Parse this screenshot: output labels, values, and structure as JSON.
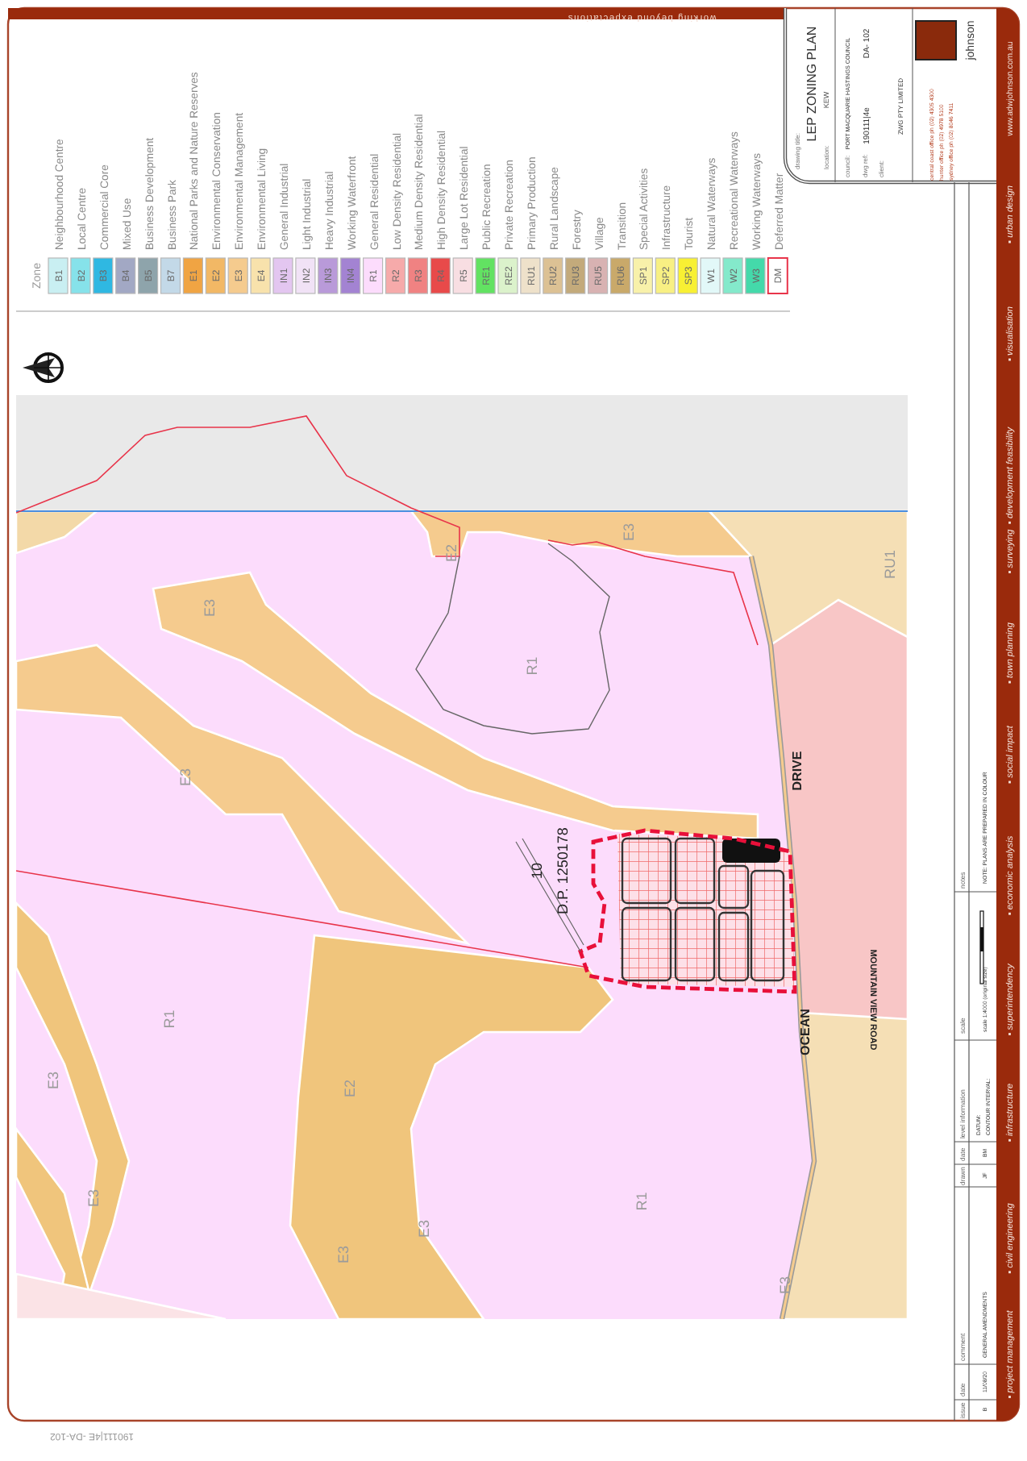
{
  "header_strip": {
    "tagline": "working beyond expectations"
  },
  "legend": {
    "title": "Zone",
    "items": [
      {
        "code": "B1",
        "label": "Neighbourhood Centre",
        "color": "#c9eff2"
      },
      {
        "code": "B2",
        "label": "Local Centre",
        "color": "#86e2ea"
      },
      {
        "code": "B3",
        "label": "Commercial Core",
        "color": "#2fb8e2"
      },
      {
        "code": "B4",
        "label": "Mixed Use",
        "color": "#a2a8c4"
      },
      {
        "code": "B5",
        "label": "Business Development",
        "color": "#8ea4ab"
      },
      {
        "code": "B7",
        "label": "Business Park",
        "color": "#c3d9e8"
      },
      {
        "code": "E1",
        "label": "National Parks and Nature Reserves",
        "color": "#f0a443"
      },
      {
        "code": "E2",
        "label": "Environmental Conservation",
        "color": "#f2b865"
      },
      {
        "code": "E3",
        "label": "Environmental Management",
        "color": "#f5cb8e"
      },
      {
        "code": "E4",
        "label": "Environmental Living",
        "color": "#f8e2ac"
      },
      {
        "code": "IN1",
        "label": "General Industrial",
        "color": "#e3c6f0"
      },
      {
        "code": "IN2",
        "label": "Light Industrial",
        "color": "#f1e2f6"
      },
      {
        "code": "IN3",
        "label": "Heavy Industrial",
        "color": "#b99ad9"
      },
      {
        "code": "IN4",
        "label": "Working Waterfront",
        "color": "#a383d2"
      },
      {
        "code": "R1",
        "label": "General Residential",
        "color": "#fcdcfc"
      },
      {
        "code": "R2",
        "label": "Low Density Residential",
        "color": "#f6aaaa"
      },
      {
        "code": "R3",
        "label": "Medium Density Residential",
        "color": "#f08282"
      },
      {
        "code": "R4",
        "label": "High Density Residential",
        "color": "#e84a4a"
      },
      {
        "code": "R5",
        "label": "Large Lot Residential",
        "color": "#f8dee2"
      },
      {
        "code": "RE1",
        "label": "Public Recreation",
        "color": "#62e262"
      },
      {
        "code": "RE2",
        "label": "Private Recreation",
        "color": "#dbf2cb"
      },
      {
        "code": "RU1",
        "label": "Primary Production",
        "color": "#eee1ca"
      },
      {
        "code": "RU2",
        "label": "Rural Landscape",
        "color": "#dcc194"
      },
      {
        "code": "RU3",
        "label": "Forestry",
        "color": "#c3aa7b"
      },
      {
        "code": "RU5",
        "label": "Village",
        "color": "#d8b2b2"
      },
      {
        "code": "RU6",
        "label": "Transition",
        "color": "#c9a96a"
      },
      {
        "code": "SP1",
        "label": "Special Activities",
        "color": "#f8f1aa"
      },
      {
        "code": "SP2",
        "label": "Infrastructure",
        "color": "#f8f083"
      },
      {
        "code": "SP3",
        "label": "Tourist",
        "color": "#f8f033"
      },
      {
        "code": "W1",
        "label": "Natural Waterways",
        "color": "#e2f8f8"
      },
      {
        "code": "W2",
        "label": "Recreational Waterways",
        "color": "#84e9cb"
      },
      {
        "code": "W3",
        "label": "Working Waterways",
        "color": "#44d9aa"
      },
      {
        "code": "DM",
        "label": "Deferred Matter",
        "color": "#ffffff",
        "kind": "outlined"
      }
    ]
  },
  "map": {
    "zone_labels": [
      "E2",
      "E3",
      "E3",
      "R1",
      "RU1",
      "E3",
      "R1",
      "E2",
      "E3",
      "E3",
      "E3",
      "E3",
      "R1",
      "E3"
    ],
    "lot_number": "10",
    "lot_plan": "D.P. 1250178",
    "roads": [
      "DRIVE",
      "OCEAN",
      "MOUNTAIN VIEW ROAD"
    ]
  },
  "title_block": {
    "drawing_title_label": "drawing title:",
    "drawing_title": "LEP ZONING PLAN",
    "location_label": "location:",
    "location": "KEW",
    "council_label": "council:",
    "council": "PORT MACQUARIE HASTINGS COUNCIL",
    "dwg_ref_label": "dwg ref:",
    "dwg_ref": "190111|4e",
    "sheet": "DA- 102",
    "client_label": "client:",
    "client": "ZWG PTY LIMITED",
    "company": "johnson",
    "offices": [
      "central coast office ph (02) 4305 4300",
      "hunter office ph (02) 4978 5100",
      "sydney office ph (02) 8046 7411"
    ],
    "website": "www.adwjohnson.com.au"
  },
  "services": [
    "▪ project management",
    "▪ civil engineering",
    "▪ infrastructure",
    "▪ superintendency",
    "▪ economic analysis",
    "▪ social impact",
    "▪ town planning",
    "▪ surveying",
    "▪ development feasibility",
    "▪ visualisation",
    "▪ urban design"
  ],
  "revisions": {
    "headers": [
      "issue",
      "date",
      "comment",
      "drawn",
      "date",
      "level information",
      "scale",
      "notes"
    ],
    "values": [
      "B",
      "11/08/20",
      "GENERAL AMENDMENTS",
      "JF",
      "BM",
      "DATUM:",
      "CONTOUR INTERVAL:",
      "scale 1:4000 (original size)",
      "NOTE: PLANS ARE PREPARED IN COLOUR"
    ]
  },
  "file_ref": "190111|4E -DA-102"
}
